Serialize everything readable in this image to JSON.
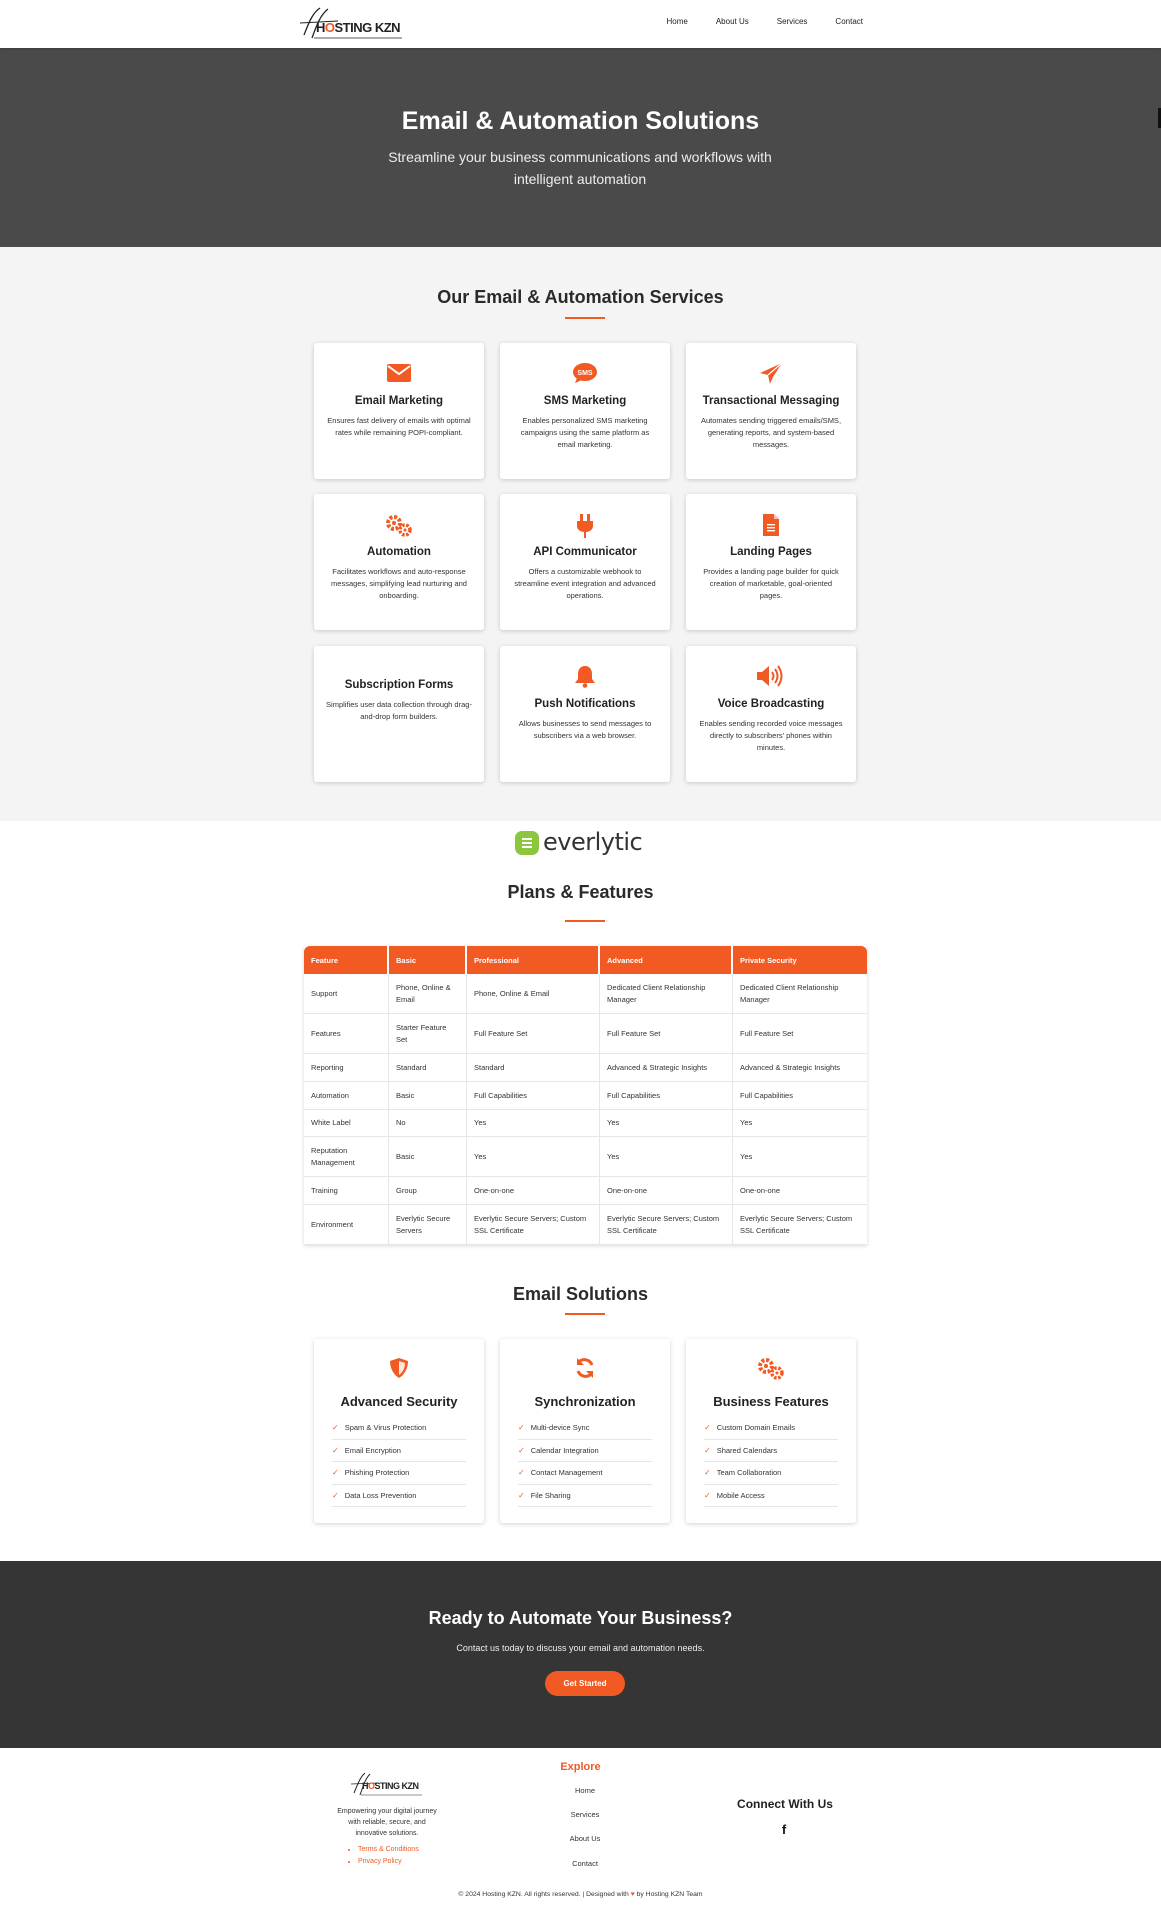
{
  "nav": {
    "brand_logo": "Hosting KZN",
    "links": [
      "Home",
      "About Us",
      "Services",
      "Contact"
    ]
  },
  "hero": {
    "title": "Email & Automation Solutions",
    "subtitle": "Streamline your business communications and workflows with intelligent automation"
  },
  "services": {
    "title": "Our Email & Automation Services",
    "cards": [
      {
        "icon": "envelope-icon",
        "title": "Email Marketing",
        "text": "Ensures fast delivery of emails with optimal rates while remaining POPI-compliant."
      },
      {
        "icon": "sms-icon",
        "title": "SMS Marketing",
        "text": "Enables personalized SMS marketing campaigns using the same platform as email marketing."
      },
      {
        "icon": "paper-plane-icon",
        "title": "Transactional Messaging",
        "text": "Automates sending triggered emails/SMS, generating reports, and system-based messages."
      },
      {
        "icon": "gears-icon",
        "title": "Automation",
        "text": "Facilitates workflows and auto-response messages, simplifying lead nurturing and onboarding."
      },
      {
        "icon": "plug-icon",
        "title": "API Communicator",
        "text": "Offers a customizable webhook to streamline event integration and advanced operations."
      },
      {
        "icon": "file-icon",
        "title": "Landing Pages",
        "text": "Provides a landing page builder for quick creation of marketable, goal-oriented pages."
      },
      {
        "icon": "",
        "title": "Subscription Forms",
        "text": "Simplifies user data collection through drag-and-drop form builders."
      },
      {
        "icon": "bell-icon",
        "title": "Push Notifications",
        "text": "Allows businesses to send messages to subscribers via a web browser."
      },
      {
        "icon": "speaker-icon",
        "title": "Voice Broadcasting",
        "text": "Enables sending recorded voice messages directly to subscribers' phones within minutes."
      }
    ]
  },
  "plans": {
    "partner_logo": "everlytic",
    "title": "Plans & Features",
    "headers": [
      "Feature",
      "Basic",
      "Professional",
      "Advanced",
      "Private Security"
    ],
    "rows": [
      [
        "Support",
        "Phone, Online & Email",
        "Phone, Online & Email",
        "Dedicated Client Relationship Manager",
        "Dedicated Client Relationship Manager"
      ],
      [
        "Features",
        "Starter Feature Set",
        "Full Feature Set",
        "Full Feature Set",
        "Full Feature Set"
      ],
      [
        "Reporting",
        "Standard",
        "Standard",
        "Advanced & Strategic Insights",
        "Advanced & Strategic Insights"
      ],
      [
        "Automation",
        "Basic",
        "Full Capabilities",
        "Full Capabilities",
        "Full Capabilities"
      ],
      [
        "White Label",
        "No",
        "Yes",
        "Yes",
        "Yes"
      ],
      [
        "Reputation Management",
        "Basic",
        "Yes",
        "Yes",
        "Yes"
      ],
      [
        "Training",
        "Group",
        "One-on-one",
        "One-on-one",
        "One-on-one"
      ],
      [
        "Environment",
        "Everlytic Secure Servers",
        "Everlytic Secure Servers; Custom SSL Certificate",
        "Everlytic Secure Servers; Custom SSL Certificate",
        "Everlytic Secure Servers; Custom SSL Certificate"
      ]
    ]
  },
  "solutions": {
    "title": "Email Solutions",
    "check_mark": "✓",
    "cards": [
      {
        "icon": "shield-icon",
        "title": "Advanced Security",
        "items": [
          "Spam & Virus Protection",
          "Email Encryption",
          "Phishing Protection",
          "Data Loss Prevention"
        ]
      },
      {
        "icon": "sync-icon",
        "title": "Synchronization",
        "items": [
          "Multi-device Sync",
          "Calendar Integration",
          "Contact Management",
          "File Sharing"
        ]
      },
      {
        "icon": "gears-icon",
        "title": "Business Features",
        "items": [
          "Custom Domain Emails",
          "Shared Calendars",
          "Team Collaboration",
          "Mobile Access"
        ]
      }
    ]
  },
  "cta": {
    "title": "Ready to Automate Your Business?",
    "text": "Contact us today to discuss your email and automation needs.",
    "button": "Get Started"
  },
  "footer": {
    "tagline": "Empowering your digital journey with reliable, secure, and innovative solutions.",
    "legal_links": [
      "Terms & Conditions",
      "Privacy Policy"
    ],
    "explore_title": "Explore",
    "explore_links": [
      "Home",
      "Services",
      "About Us",
      "Contact"
    ],
    "connect_title": "Connect With Us",
    "social_icon": "facebook-icon",
    "social_glyph": "f",
    "copyright_before": "© 2024 Hosting KZN. All rights reserved. | Designed with",
    "heart": "♥",
    "copyright_after": "by Hosting KZN Team"
  },
  "colors": {
    "accent": "#f15a22",
    "hero_bg": "#4a4a4a",
    "cta_bg": "#353535",
    "section_bg": "#f4f4f4",
    "everlytic_green": "#8cc63f"
  }
}
